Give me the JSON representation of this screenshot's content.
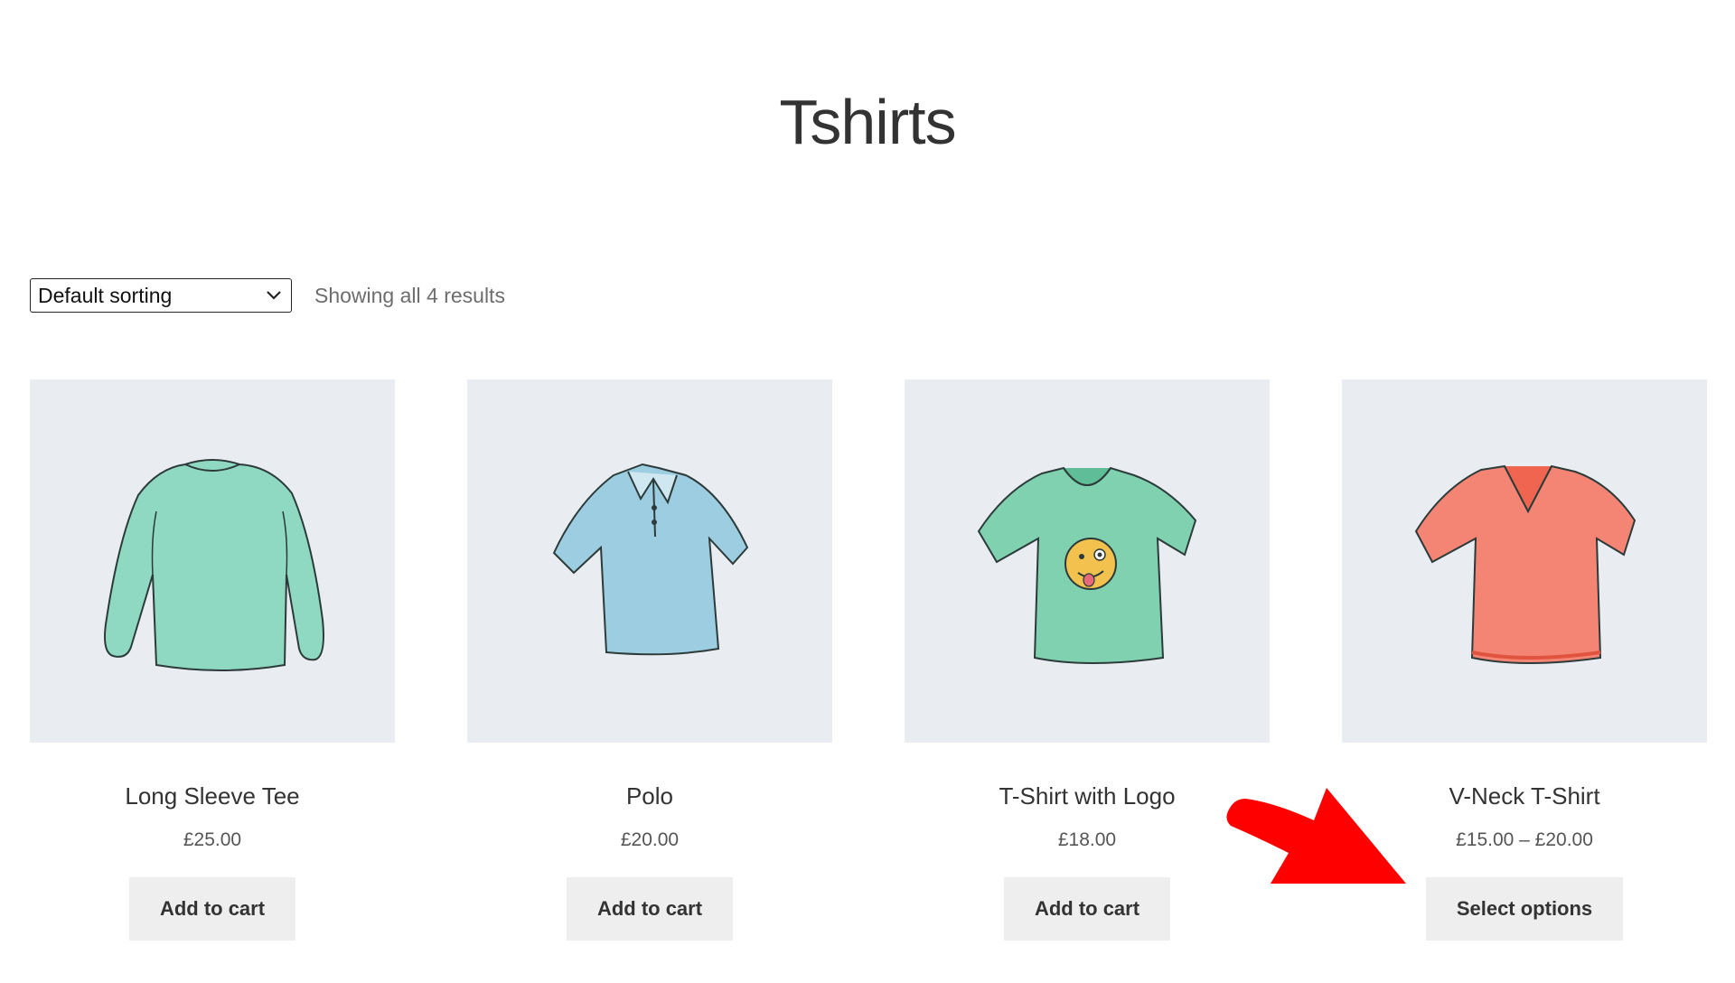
{
  "page": {
    "title": "Tshirts"
  },
  "toolbar": {
    "sort_selected": "Default sorting",
    "result_count": "Showing all 4 results"
  },
  "products": [
    {
      "name": "Long Sleeve Tee",
      "price": "£25.00",
      "button_label": "Add to cart",
      "color": "#8fd9c2",
      "icon": "long-sleeve-shirt-icon"
    },
    {
      "name": "Polo",
      "price": "£20.00",
      "button_label": "Add to cart",
      "color": "#9dcde0",
      "icon": "polo-shirt-icon"
    },
    {
      "name": "T-Shirt with Logo",
      "price": "£18.00",
      "button_label": "Add to cart",
      "color": "#7fd1b0",
      "icon": "tshirt-with-logo-icon"
    },
    {
      "name": "V-Neck T-Shirt",
      "price": "£15.00 – £20.00",
      "button_label": "Select options",
      "color": "#f48574",
      "icon": "vneck-tshirt-icon"
    }
  ],
  "colors": {
    "image_background": "#e9edf1",
    "button_background": "#eeeeee",
    "arrow": "#ff0000"
  }
}
